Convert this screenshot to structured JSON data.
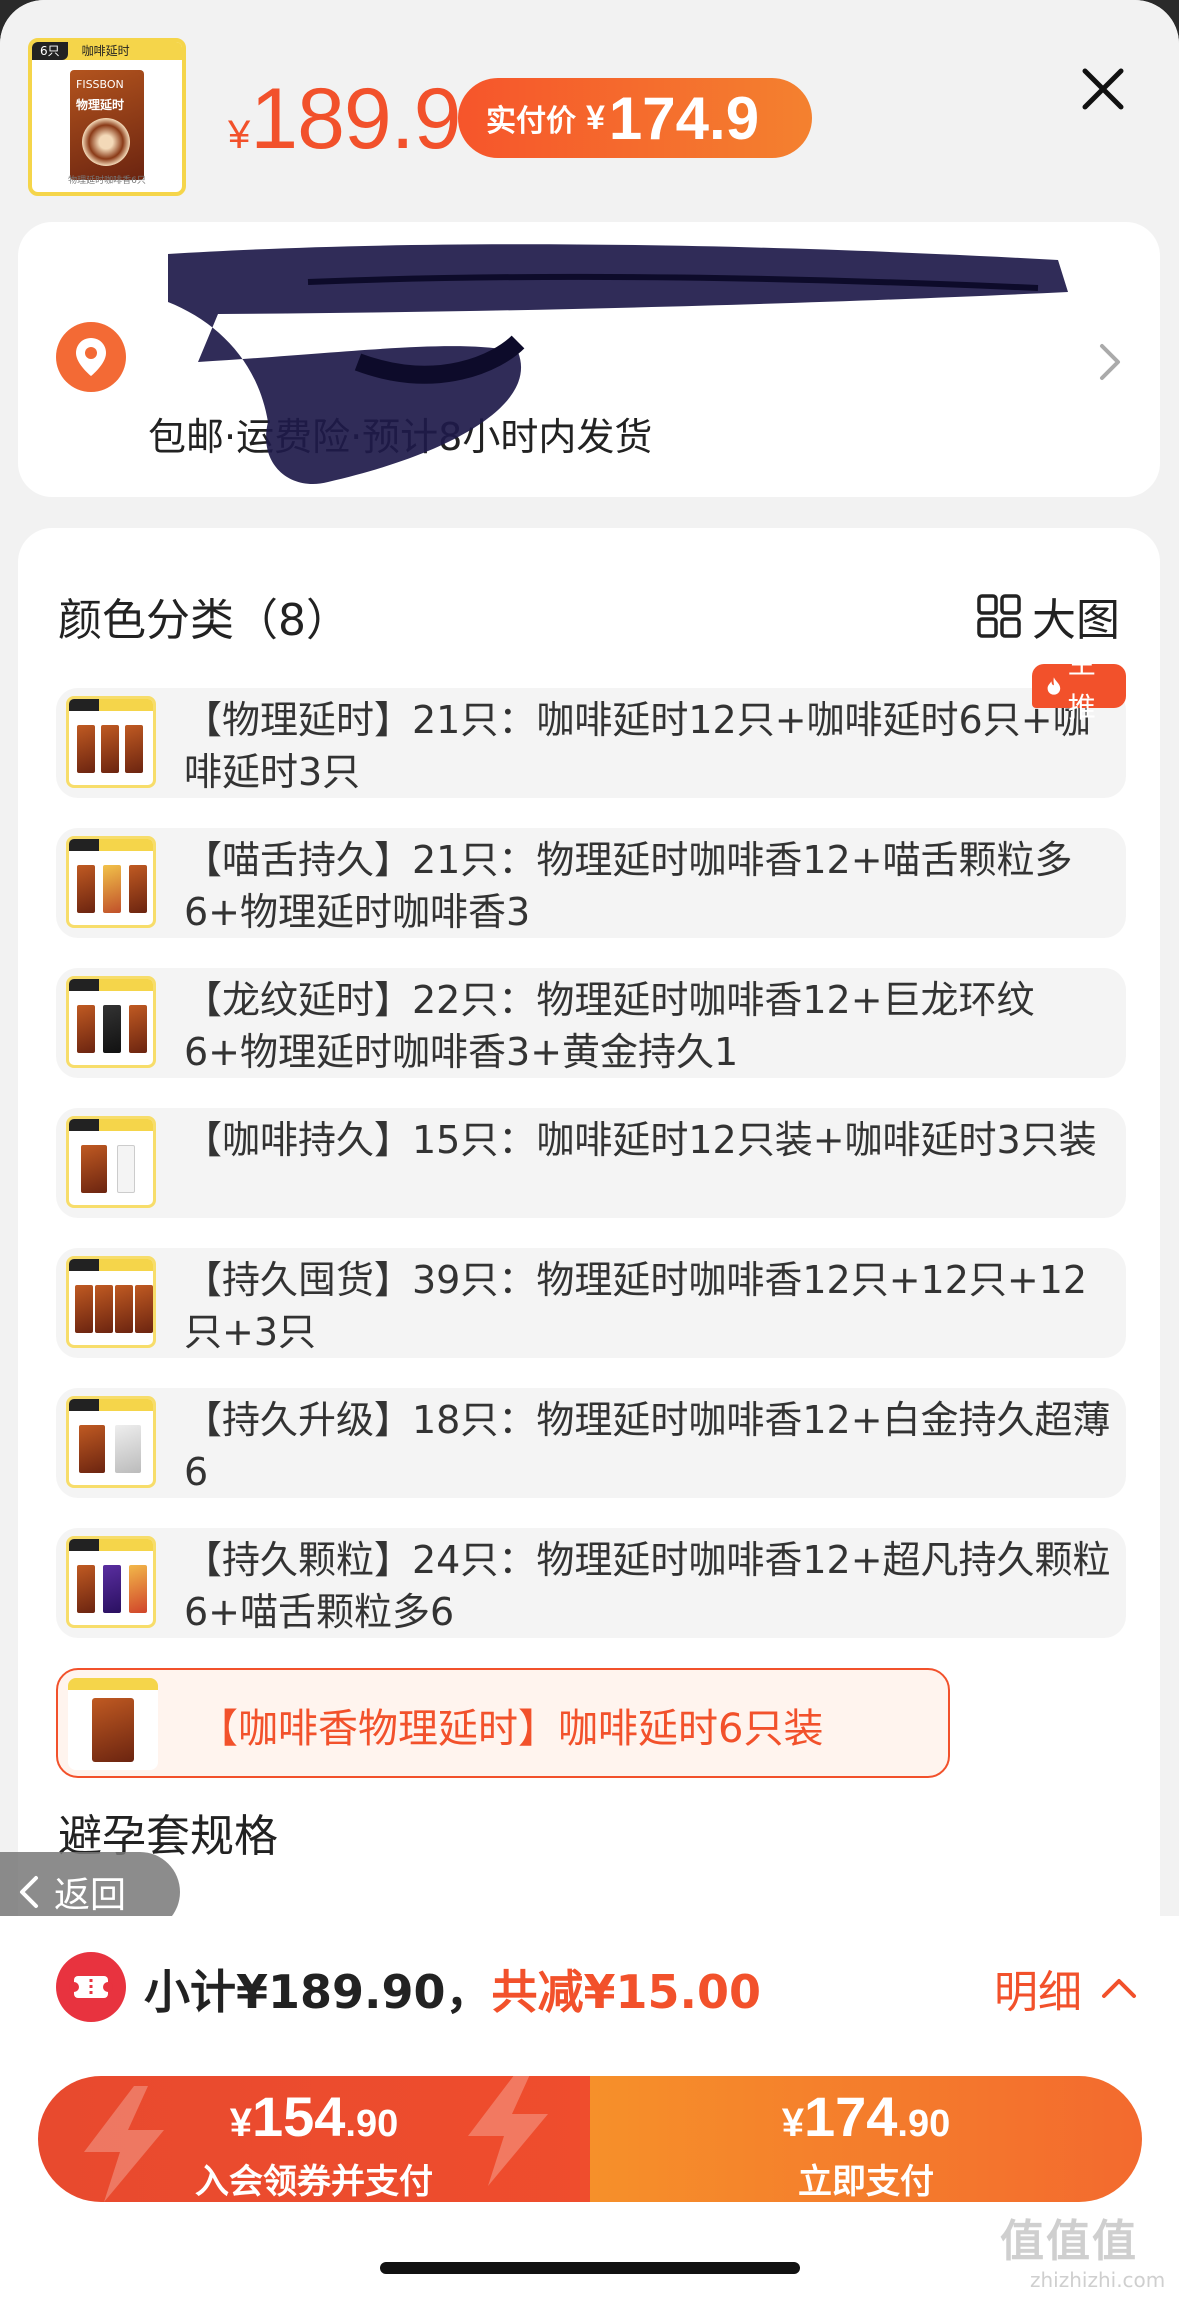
{
  "header": {
    "thumb_tag_left": "6只",
    "thumb_tag_right": "咖啡延时",
    "thumb_brand": "FISSBON",
    "thumb_name": "物理延时",
    "thumb_caption": "物理延时咖啡香6只",
    "price_currency": "¥",
    "price_value": "189.9",
    "paid_label": "实付价",
    "paid_currency": "¥",
    "paid_value": "174.9"
  },
  "address": {
    "line1": "",
    "line2": "",
    "shipping": "包邮·运费险·预计8小时内发货"
  },
  "options": {
    "section_title": "颜色分类（8）",
    "big_view_label": "大图",
    "hot_badge": "主推",
    "items": [
      {
        "text": "【物理延时】21只：咖啡延时12只+咖啡延时6只+咖啡延时3只"
      },
      {
        "text": "【喵舌持久】21只：物理延时咖啡香12+喵舌颗粒多6+物理延时咖啡香3"
      },
      {
        "text": "【龙纹延时】22只：物理延时咖啡香12+巨龙环纹6+物理延时咖啡香3+黄金持久1"
      },
      {
        "text": "【咖啡持久】15只：咖啡延时12只装+咖啡延时3只装"
      },
      {
        "text": "【持久囤货】39只：物理延时咖啡香12只+12只+12只+3只"
      },
      {
        "text": "【持久升级】18只：物理延时咖啡香12+白金持久超薄6"
      },
      {
        "text": "【持久颗粒】24只：物理延时咖啡香12+超凡持久颗粒6+喵舌颗粒多6"
      }
    ],
    "selected": {
      "text": "【咖啡香物理延时】咖啡延时6只装"
    },
    "spec_title": "避孕套规格"
  },
  "back": {
    "label": "返回"
  },
  "summary": {
    "subtotal": "小计¥189.90，",
    "discount": "共减¥15.00",
    "detail_label": "明细"
  },
  "pay": {
    "left": {
      "yen": "¥",
      "int": "154",
      "dec": ".90",
      "label": "入会领券并支付"
    },
    "right": {
      "yen": "¥",
      "int": "174",
      "dec": ".90",
      "label": "立即支付"
    }
  },
  "watermark": {
    "main": "值值值",
    "sub": "zhizhizhi.com"
  },
  "colors": {
    "accent": "#f2512b",
    "selected_bg": "#fff4ee",
    "pay_left": "#e84a2e",
    "pay_right": "#f6902a"
  }
}
